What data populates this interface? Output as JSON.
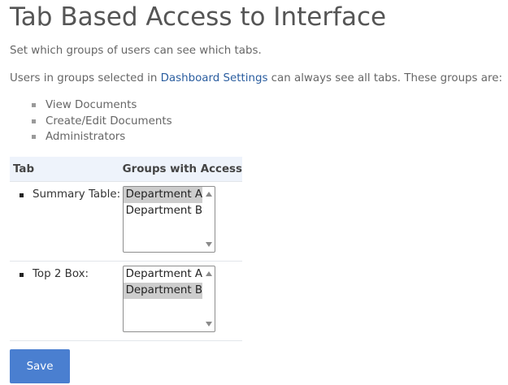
{
  "page": {
    "title": "Tab Based Access to Interface",
    "intro": "Set which groups of users can see which tabs.",
    "note_before": "Users in groups selected in ",
    "note_link": "Dashboard Settings",
    "note_after": " can always see all tabs. These groups are:",
    "always_visible_groups": [
      "View Documents",
      "Create/Edit Documents",
      "Administrators"
    ]
  },
  "table": {
    "headers": {
      "tab": "Tab",
      "groups": "Groups with Access"
    },
    "rows": [
      {
        "tab": "Summary Table:",
        "options": [
          {
            "label": "Department A",
            "selected": true
          },
          {
            "label": "Department B",
            "selected": false
          }
        ]
      },
      {
        "tab": "Top 2 Box:",
        "options": [
          {
            "label": "Department A",
            "selected": false
          },
          {
            "label": "Department B",
            "selected": true
          }
        ]
      }
    ]
  },
  "actions": {
    "save_label": "Save"
  },
  "colors": {
    "link": "#2a5d9f",
    "header_bg": "#eef3fb",
    "selected_option": "#cdcdcd",
    "save_button": "#4a7fd0"
  }
}
